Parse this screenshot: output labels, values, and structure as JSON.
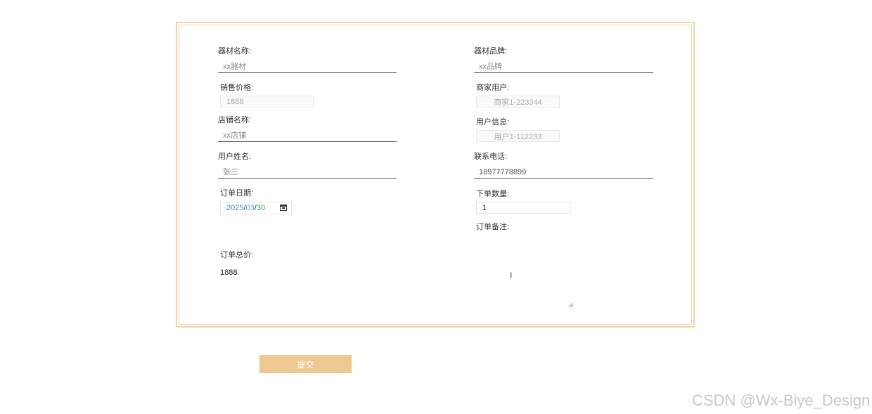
{
  "form": {
    "equipment_name": {
      "label": "器材名称:",
      "placeholder": "xx器材"
    },
    "equipment_brand": {
      "label": "器材品牌:",
      "placeholder": "xx品牌"
    },
    "sale_price": {
      "label": "销售价格:",
      "value": "1888"
    },
    "merchant_user": {
      "label": "商家用户:",
      "value": "商家1-223344"
    },
    "shop_name": {
      "label": "店铺名称:",
      "placeholder": "xx店铺"
    },
    "user_info": {
      "label": "用户信息:",
      "value": "用户1-112233"
    },
    "user_name": {
      "label": "用户姓名:",
      "placeholder": "张三"
    },
    "phone": {
      "label": "联系电话:",
      "value": "18977778899"
    },
    "order_date": {
      "label": "订单日期:",
      "year": "2025",
      "month": "03",
      "day": "30",
      "separator": "/"
    },
    "quantity": {
      "label": "下单数量:",
      "value": "1"
    },
    "remark": {
      "label": "订单备注:"
    },
    "total": {
      "label": "订单总价:",
      "value": "1888"
    }
  },
  "submit_label": "提交",
  "watermark": "CSDN @Wx-Biye_Design",
  "colors": {
    "accent": "#eec891",
    "frame": "#eed7a8"
  }
}
